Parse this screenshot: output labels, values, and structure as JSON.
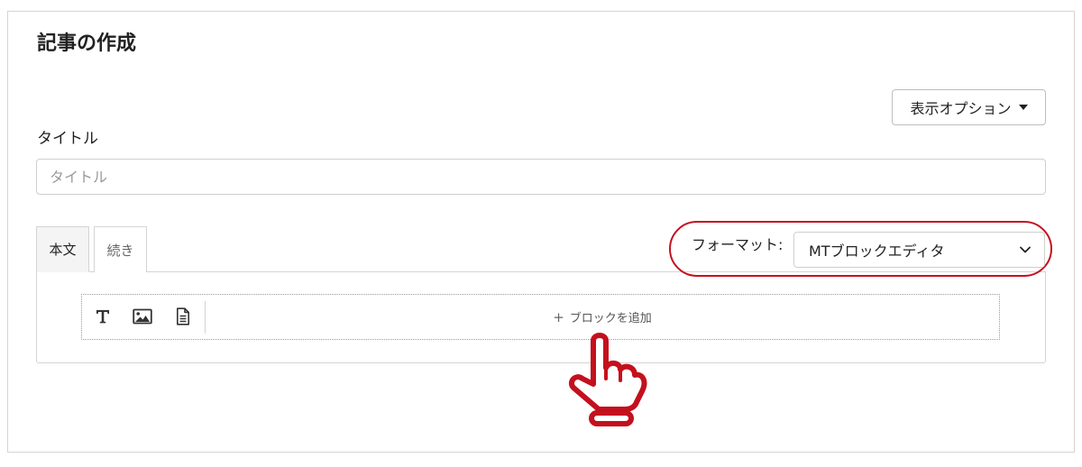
{
  "page": {
    "title": "記事の作成"
  },
  "header": {
    "display_options_label": "表示オプション"
  },
  "title_field": {
    "label": "タイトル",
    "placeholder": "タイトル",
    "value": ""
  },
  "editor": {
    "tabs": [
      {
        "label": "本文",
        "active": true
      },
      {
        "label": "続き",
        "active": false
      }
    ],
    "format": {
      "label": "フォーマット:",
      "selected": "MTブロックエディタ"
    },
    "block_tools": [
      {
        "icon": "text-icon"
      },
      {
        "icon": "image-icon"
      },
      {
        "icon": "document-icon"
      }
    ],
    "add_block_label": "ブロックを追加"
  },
  "colors": {
    "highlight": "#c4101e",
    "border": "#d4d4d4",
    "active_tab_bg": "#f4f4f4"
  }
}
